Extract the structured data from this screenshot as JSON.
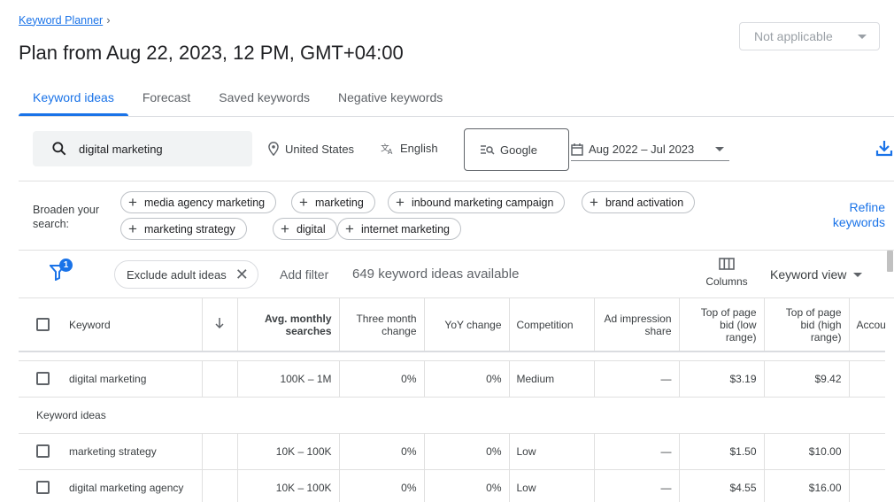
{
  "breadcrumb": {
    "link": "Keyword Planner",
    "chevron": "›"
  },
  "page_title": "Plan from Aug 22, 2023, 12 PM, GMT+04:00",
  "top_right_select": {
    "value": "Not applicable"
  },
  "tabs": [
    {
      "label": "Keyword ideas",
      "active": true
    },
    {
      "label": "Forecast",
      "active": false
    },
    {
      "label": "Saved keywords",
      "active": false
    },
    {
      "label": "Negative keywords",
      "active": false
    }
  ],
  "search": {
    "query": "digital marketing",
    "location": "United States",
    "language": "English",
    "engine": "Google",
    "date_range": "Aug 2022 – Jul 2023"
  },
  "broaden": {
    "label": "Broaden your search:",
    "chips": [
      "media agency marketing",
      "marketing",
      "inbound marketing campaign",
      "brand activation",
      "marketing strategy",
      "digital",
      "internet marketing"
    ],
    "refine_label_line1": "Refine",
    "refine_label_line2": "keywords"
  },
  "filters": {
    "badge_count": "1",
    "exclude_chip": "Exclude adult ideas",
    "add_filter": "Add filter",
    "ideas_available": "649 keyword ideas available",
    "columns_label": "Columns",
    "view_label": "Keyword view"
  },
  "table": {
    "headers": {
      "keyword": "Keyword",
      "avg_monthly_1": "Avg. monthly",
      "avg_monthly_2": "searches",
      "three_month_1": "Three month",
      "three_month_2": "change",
      "yoy": "YoY change",
      "competition": "Competition",
      "ad_impr_1": "Ad impression",
      "ad_impr_2": "share",
      "top_low_1": "Top of page",
      "top_low_2": "bid (low",
      "top_low_3": "range)",
      "top_high_1": "Top of page",
      "top_high_2": "bid (high",
      "top_high_3": "range)",
      "account": "Accou"
    },
    "seed_row": {
      "keyword": "digital marketing",
      "avg": "100K – 1M",
      "three_month": "0%",
      "yoy": "0%",
      "competition": "Medium",
      "ad_impr": "—",
      "bid_low": "$3.19",
      "bid_high": "$9.42"
    },
    "section_label": "Keyword ideas",
    "rows": [
      {
        "keyword": "marketing strategy",
        "avg": "10K – 100K",
        "three_month": "0%",
        "yoy": "0%",
        "competition": "Low",
        "ad_impr": "—",
        "bid_low": "$1.50",
        "bid_high": "$10.00"
      },
      {
        "keyword": "digital marketing agency",
        "avg": "10K – 100K",
        "three_month": "0%",
        "yoy": "0%",
        "competition": "Low",
        "ad_impr": "—",
        "bid_low": "$4.55",
        "bid_high": "$16.00"
      }
    ]
  },
  "colors": {
    "accent": "#1a73e8",
    "text": "#202124",
    "muted": "#5f6368",
    "border": "#e0e0e0"
  }
}
